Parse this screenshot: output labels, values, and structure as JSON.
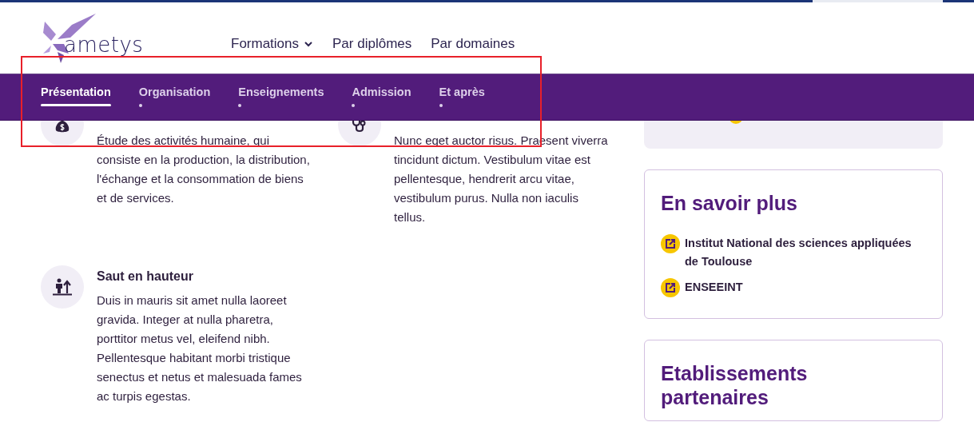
{
  "header": {
    "logo": "ametys",
    "menu": [
      {
        "label": "Formations",
        "dropdown": true
      },
      {
        "label": "Par diplômes",
        "dropdown": false
      },
      {
        "label": "Par domaines",
        "dropdown": false
      }
    ]
  },
  "section_tabs": [
    {
      "label": "Présentation",
      "selected": true
    },
    {
      "label": "Organisation",
      "selected": false
    },
    {
      "label": "Enseignements",
      "selected": false
    },
    {
      "label": "Admission",
      "selected": false
    },
    {
      "label": "Et après",
      "selected": false
    }
  ],
  "features": [
    {
      "text": "Étude des activités humaine, qui consiste en la production, la distribution, l'échange et la consommation de biens et de services."
    },
    {
      "text": "Nunc eget auctor risus. Praesent viverra tincidunt dictum. Vestibulum vitae est pellentesque, hendrerit arcu vitae, vestibulum purus. Nulla non iaculis tellus."
    },
    {
      "title": "Saut en hauteur",
      "text": "Duis in mauris sit amet nulla laoreet gravida. Integer at nulla pharetra, porttitor metus vel, eleifend nibh. Pellentesque habitant morbi tristique senectus et netus et malesuada fames ac turpis egestas."
    }
  ],
  "links_card": {
    "title": "En savoir plus",
    "links": [
      "Institut National des sciences appliquées de Toulouse",
      "ENSEEINT"
    ]
  },
  "partners_card": {
    "title": "Etablissements partenaires"
  }
}
